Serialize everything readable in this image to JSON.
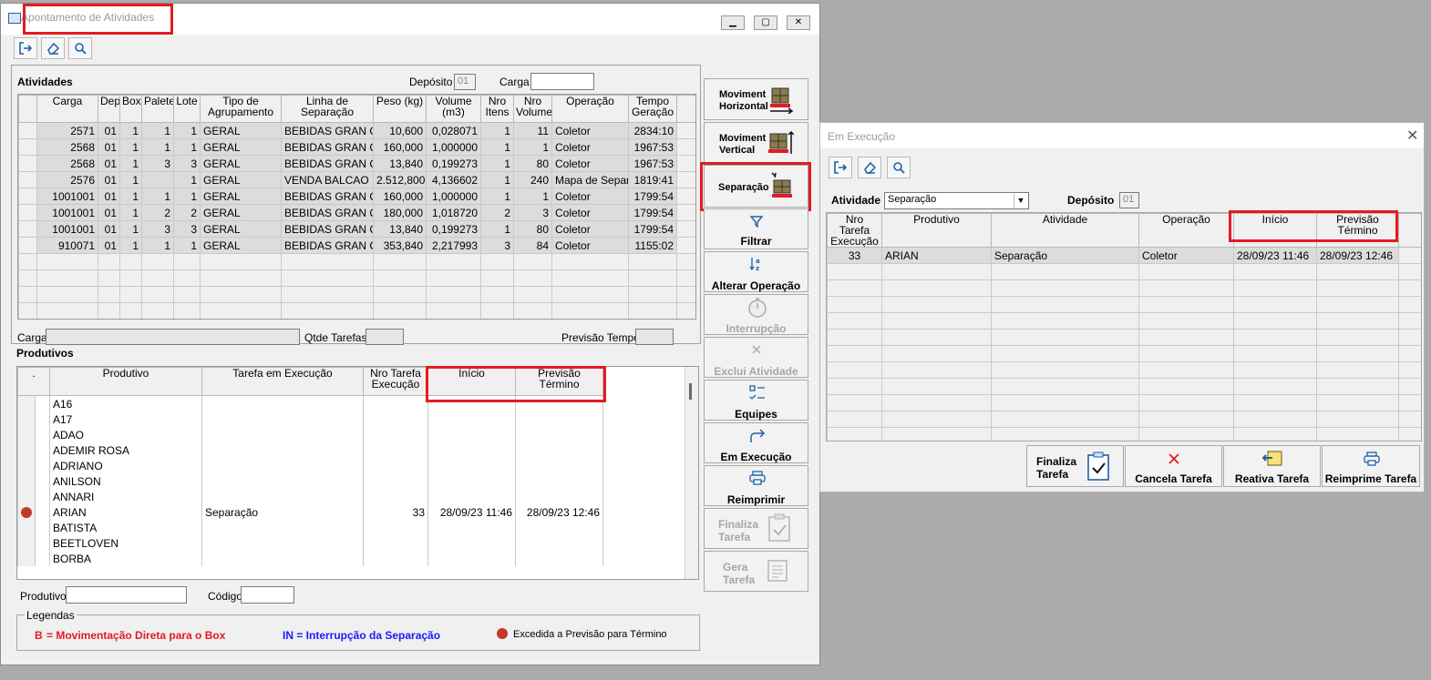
{
  "main": {
    "title": "Apontamento de Atividades",
    "atividades": {
      "heading": "Atividades",
      "deposito_label": "Depósito",
      "deposito_value": "01",
      "carga_label": "Carga",
      "carga_value": "",
      "headers": [
        "Carga",
        "Dep",
        "Box",
        "Palete",
        "Lote",
        "Tipo de Agrupamento",
        "Linha de Separação",
        "Peso (kg)",
        "Volume (m3)",
        "Nro Itens",
        "Nro Volume",
        "Operação",
        "Tempo Geração"
      ],
      "rows": [
        [
          "2571",
          "01",
          "1",
          "1",
          "1",
          "GERAL",
          "BEBIDAS GRAN CL",
          "10,600",
          "0,028071",
          "1",
          "11",
          "Coletor",
          "2834:10"
        ],
        [
          "2568",
          "01",
          "1",
          "1",
          "1",
          "GERAL",
          "BEBIDAS GRAN CL",
          "160,000",
          "1,000000",
          "1",
          "1",
          "Coletor",
          "1967:53"
        ],
        [
          "2568",
          "01",
          "1",
          "3",
          "3",
          "GERAL",
          "BEBIDAS GRAN CL",
          "13,840",
          "0,199273",
          "1",
          "80",
          "Coletor",
          "1967:53"
        ],
        [
          "2576",
          "01",
          "1",
          "",
          "1",
          "GERAL",
          "VENDA BALCAO",
          "2.512,800",
          "4,136602",
          "1",
          "240",
          "Mapa de Separa",
          "1819:41"
        ],
        [
          "1001001",
          "01",
          "1",
          "1",
          "1",
          "GERAL",
          "BEBIDAS GRAN CL",
          "160,000",
          "1,000000",
          "1",
          "1",
          "Coletor",
          "1799:54"
        ],
        [
          "1001001",
          "01",
          "1",
          "2",
          "2",
          "GERAL",
          "BEBIDAS GRAN CL",
          "180,000",
          "1,018720",
          "2",
          "3",
          "Coletor",
          "1799:54"
        ],
        [
          "1001001",
          "01",
          "1",
          "3",
          "3",
          "GERAL",
          "BEBIDAS GRAN CL",
          "13,840",
          "0,199273",
          "1",
          "80",
          "Coletor",
          "1799:54"
        ],
        [
          "910071",
          "01",
          "1",
          "1",
          "1",
          "GERAL",
          "BEBIDAS GRAN CL",
          "353,840",
          "2,217993",
          "3",
          "84",
          "Coletor",
          "1155:02"
        ]
      ],
      "carga_footer_label": "Carga",
      "qtde_label": "Qtde Tarefas",
      "previsao_label": "Previsão Tempo"
    },
    "produtivos": {
      "heading": "Produtivos",
      "headers": [
        ".",
        "Produtivo",
        "Tarefa em Execução",
        "Nro Tarefa Execução",
        "Início",
        "Previsão Término"
      ],
      "rows": [
        {
          "name": "A16",
          "tarefa": "",
          "nro": "",
          "inicio": "",
          "prev": "",
          "dot": false
        },
        {
          "name": "A17",
          "tarefa": "",
          "nro": "",
          "inicio": "",
          "prev": "",
          "dot": false
        },
        {
          "name": "ADAO",
          "tarefa": "",
          "nro": "",
          "inicio": "",
          "prev": "",
          "dot": false
        },
        {
          "name": "ADEMIR ROSA",
          "tarefa": "",
          "nro": "",
          "inicio": "",
          "prev": "",
          "dot": false
        },
        {
          "name": "ADRIANO",
          "tarefa": "",
          "nro": "",
          "inicio": "",
          "prev": "",
          "dot": false
        },
        {
          "name": "ANILSON",
          "tarefa": "",
          "nro": "",
          "inicio": "",
          "prev": "",
          "dot": false
        },
        {
          "name": "ANNARI",
          "tarefa": "",
          "nro": "",
          "inicio": "",
          "prev": "",
          "dot": false
        },
        {
          "name": "ARIAN",
          "tarefa": "Separação",
          "nro": "33",
          "inicio": "28/09/23 11:46",
          "prev": "28/09/23 12:46",
          "dot": true
        },
        {
          "name": "BATISTA",
          "tarefa": "",
          "nro": "",
          "inicio": "",
          "prev": "",
          "dot": false
        },
        {
          "name": "BEETLOVEN",
          "tarefa": "",
          "nro": "",
          "inicio": "",
          "prev": "",
          "dot": false
        },
        {
          "name": "BORBA",
          "tarefa": "",
          "nro": "",
          "inicio": "",
          "prev": "",
          "dot": false
        }
      ],
      "produtivo_label": "Produtivo",
      "codigo_label": "Código"
    },
    "legend": {
      "title": "Legendas",
      "b_symbol": "B",
      "b_text": "= Movimentação Direta para o Box",
      "in_text": "IN = Interrupção da Separação",
      "dot_text": "Excedida a Previsão para Término"
    },
    "side_buttons": {
      "horizontal": [
        "Moviment",
        "Horizontal"
      ],
      "vertical": [
        "Moviment",
        "Vertical"
      ],
      "separacao": "Separação",
      "filtrar": "Filtrar",
      "alterar": "Alterar Operação",
      "interrupcao": "Interrupção",
      "exclui": "Exclui Atividade",
      "equipes": "Equipes",
      "em_execucao": "Em Execução",
      "reimprimir": "Reimprimir",
      "finaliza": [
        "Finaliza",
        "Tarefa"
      ],
      "gera": [
        "Gera",
        "Tarefa"
      ]
    }
  },
  "exec": {
    "title": "Em Execução",
    "atividade_label": "Atividade",
    "atividade_value": "Separação",
    "deposito_label": "Depósito",
    "deposito_value": "01",
    "headers": [
      "Nro Tarefa Execução",
      "Produtivo",
      "Atividade",
      "Operação",
      "Início",
      "Previsão Término"
    ],
    "row": [
      "33",
      "ARIAN",
      "Separação",
      "Coletor",
      "28/09/23 11:46",
      "28/09/23 12:46"
    ],
    "buttons": {
      "finaliza": [
        "Finaliza",
        "Tarefa"
      ],
      "cancela": "Cancela Tarefa",
      "reativa": "Reativa Tarefa",
      "reimprime": "Reimprime Tarefa"
    }
  },
  "colors": {
    "red": "#e41b23",
    "dot": "#c0392b",
    "blue": "#1a1aff"
  }
}
